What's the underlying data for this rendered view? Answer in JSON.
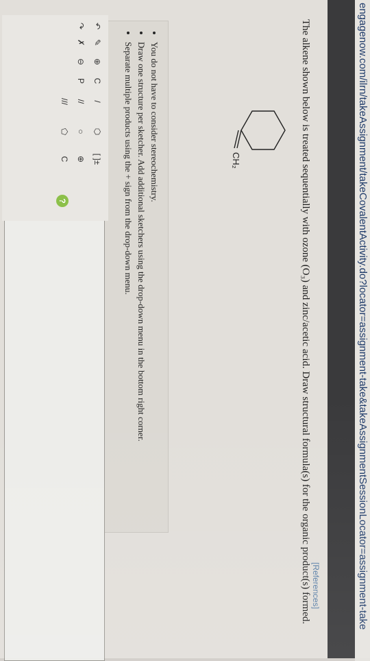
{
  "browser": {
    "url": "engagenow.com/ilrn/takeAssignment/takeCovalentActivity.do?locator=assignment-take&takeAssignmentSessionLocator=assignment-take"
  },
  "page": {
    "references": "[References]",
    "question": "The alkene shown below is treated sequentially with ozone (O₃) and zinc/acetic acid. Draw structural formula(s) for the organic product(s) formed.",
    "substituent": "CH₂",
    "bullets": [
      "You do not have to consider stereochemistry.",
      "Draw one structure per sketcher. Add additional sketchers using the drop-down menu in the bottom right corner.",
      "Separate multiple products using the + sign from the drop-down menu."
    ]
  },
  "sketcher": {
    "tools": [
      {
        "label": "↶",
        "icon": "undo-icon"
      },
      {
        "label": "↷",
        "icon": "redo-icon"
      },
      {
        "label": "✎",
        "icon": "pencil-icon"
      },
      {
        "label": "✗",
        "icon": "eraser-icon"
      },
      {
        "label": "⊕",
        "icon": "zoom-in-icon"
      },
      {
        "label": "⊖",
        "icon": "zoom-out-icon"
      },
      {
        "label": "C",
        "icon": "copy-icon"
      },
      {
        "label": "P",
        "icon": "paste-icon"
      },
      {
        "label": "/",
        "icon": "single-bond-icon"
      },
      {
        "label": "//",
        "icon": "double-bond-icon"
      },
      {
        "label": "///",
        "icon": "triple-bond-icon"
      },
      {
        "label": "⬡",
        "icon": "benzene-icon"
      },
      {
        "label": "○",
        "icon": "cyclohexane-icon"
      },
      {
        "label": "⬠",
        "icon": "cyclopentane-icon"
      },
      {
        "label": "[ ]±",
        "icon": "bracket-icon"
      },
      {
        "label": "⊕",
        "icon": "charge-icon"
      },
      {
        "label": "C",
        "icon": "atom-icon"
      }
    ],
    "help": "?"
  },
  "colors": {
    "link": "#5a7fa8",
    "help": "#8cc04a"
  }
}
